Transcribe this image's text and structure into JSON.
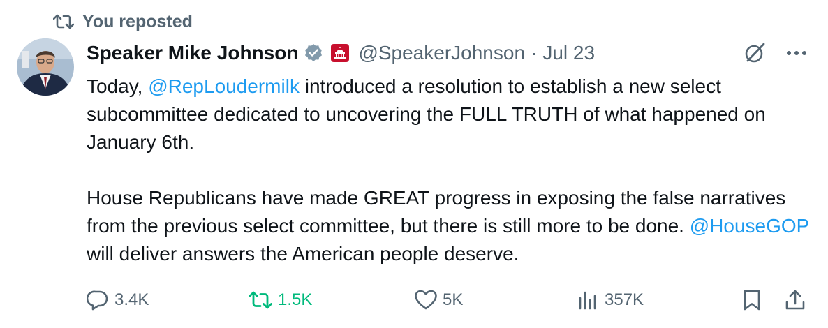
{
  "repost_banner": {
    "text": "You reposted"
  },
  "author": {
    "name": "Speaker Mike Johnson",
    "handle": "@SpeakerJohnson",
    "separator": "·",
    "date": "Jul 23"
  },
  "tweet": {
    "p1_a": "Today, ",
    "p1_mention": "@RepLoudermilk",
    "p1_b": " introduced a resolution to establish a new select subcommittee dedicated to uncovering the FULL TRUTH of what happened on January 6th.",
    "p2_a": "House Republicans have made GREAT progress in exposing the false narratives from the previous select committee, but there is still more to be done. ",
    "p2_mention": "@HouseGOP",
    "p2_b": " will deliver answers the American people deserve."
  },
  "metrics": {
    "replies": "3.4K",
    "reposts": "1.5K",
    "likes": "5K",
    "views": "357K"
  },
  "colors": {
    "text": "#0f1419",
    "secondary": "#536471",
    "link": "#1d9bf0",
    "repost_active": "#00ba7c",
    "verified": "#829aab",
    "affiliate_badge": "#c8102e"
  },
  "icons": [
    "repost-icon",
    "verified-badge-icon",
    "capitol-affiliate-icon",
    "grok-icon",
    "more-icon",
    "reply-icon",
    "like-icon",
    "views-icon",
    "bookmark-icon",
    "share-icon"
  ]
}
